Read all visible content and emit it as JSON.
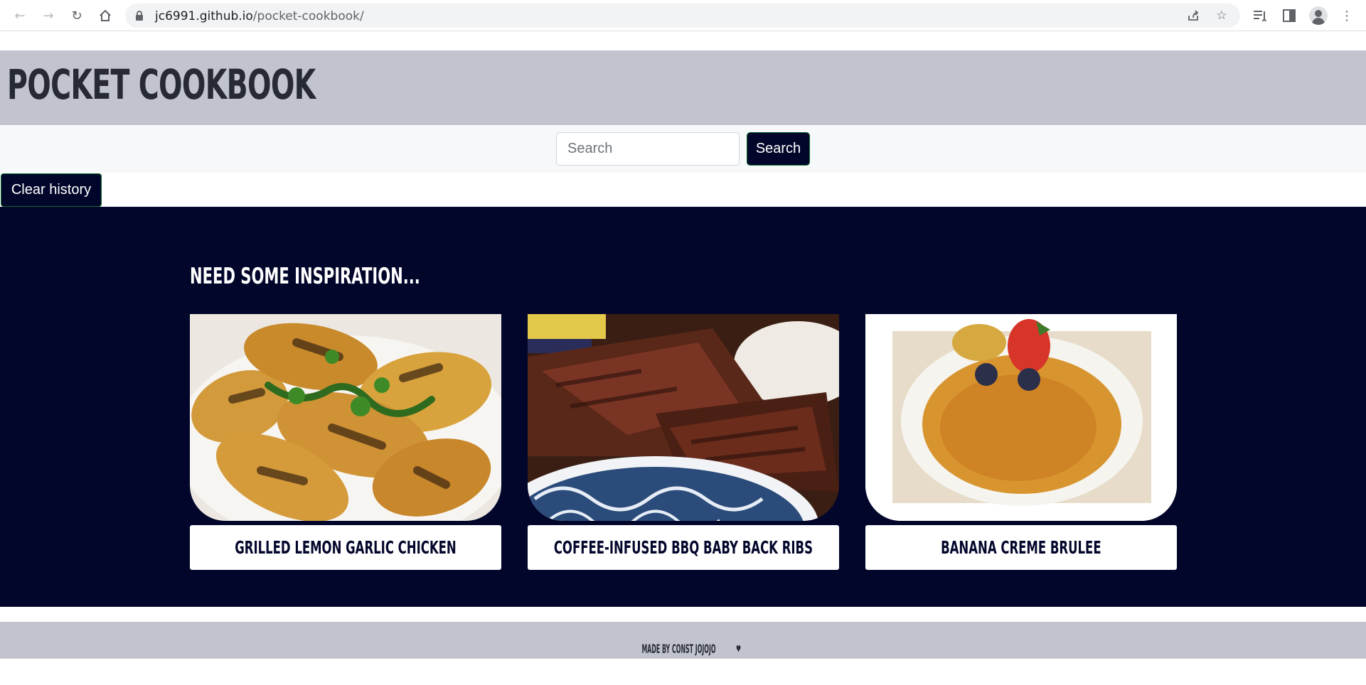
{
  "browser": {
    "url_host": "jc6991.github.io",
    "url_path": "/pocket-cookbook/"
  },
  "header": {
    "title": "POCKET COOKBOOK"
  },
  "search": {
    "placeholder": "Search",
    "button_label": "Search",
    "clear_label": "Clear history"
  },
  "inspiration": {
    "heading": "NEED SOME INSPIRATION...",
    "cards": [
      {
        "title": "GRILLED LEMON GARLIC CHICKEN"
      },
      {
        "title": "COFFEE-INFUSED BBQ BABY BACK RIBS"
      },
      {
        "title": "BANANA CREME BRULEE"
      }
    ]
  },
  "footer": {
    "text": "MADE BY CONST JOJOJO"
  },
  "colors": {
    "header_bg": "#c1c4cc",
    "dark_navy": "#01062a",
    "button_bg": "#03062b",
    "button_border": "#0a6b2b"
  }
}
